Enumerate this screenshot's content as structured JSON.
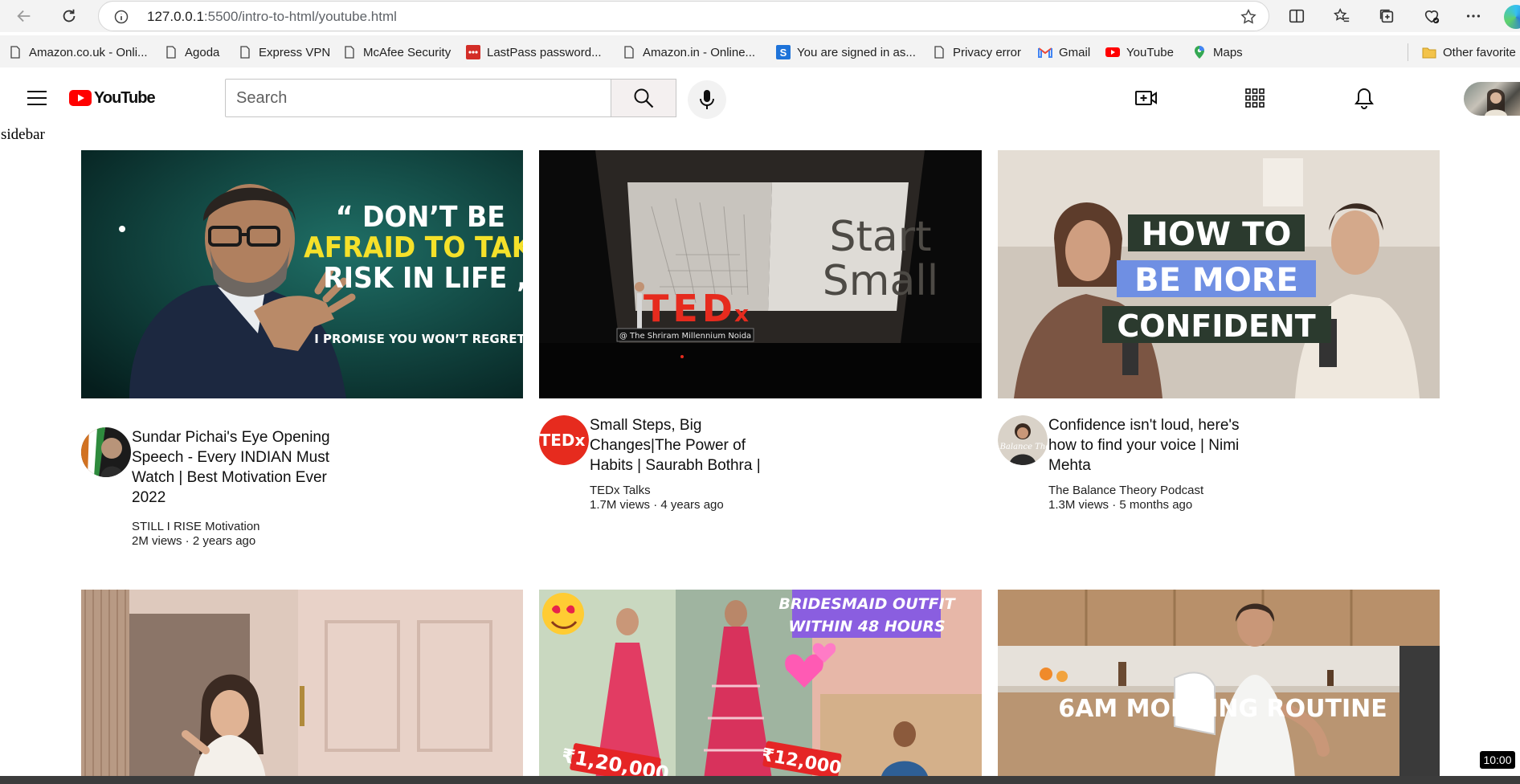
{
  "browser": {
    "url_host": "127.0.0.1",
    "url_path": ":5500/intro-to-html/youtube.html",
    "bookmarks": [
      {
        "label": "Amazon.co.uk - Onli...",
        "icon": "page-icon"
      },
      {
        "label": "Agoda",
        "icon": "page-icon"
      },
      {
        "label": "Express VPN",
        "icon": "page-icon"
      },
      {
        "label": "McAfee Security",
        "icon": "page-icon"
      },
      {
        "label": "LastPass password...",
        "icon": "lastpass-icon"
      },
      {
        "label": "Amazon.in - Online...",
        "icon": "page-icon"
      },
      {
        "label": "You are signed in as...",
        "icon": "s-icon"
      },
      {
        "label": "Privacy error",
        "icon": "page-icon"
      },
      {
        "label": "Gmail",
        "icon": "gmail-icon"
      },
      {
        "label": "YouTube",
        "icon": "youtube-icon"
      },
      {
        "label": "Maps",
        "icon": "maps-icon"
      },
      {
        "label": "Other favorite",
        "icon": "folder-icon"
      }
    ]
  },
  "header": {
    "logo_text": "YouTube",
    "search_placeholder": "Search"
  },
  "sidebar": {
    "label": "sidebar"
  },
  "videos": [
    {
      "title": "Sundar Pichai's Eye Opening Speech - Every INDIAN Must Watch | Best Motivation Ever 2022",
      "channel": "STILL I RISE Motivation",
      "stats": "2M views · 2 years ago",
      "thumb_lines": [
        "“ DON’T BE",
        "AFRAID TO TAKE",
        "RISK IN LIFE „",
        "I PROMISE YOU WON’T REGRET  IT"
      ]
    },
    {
      "title": "Small Steps, Big Changes|The Power of Habits | Saurabh Bothra |",
      "channel": "TEDx Talks",
      "stats": "1.7M views · 4 years ago",
      "thumb_lines": [
        "Start",
        "Small",
        "TED",
        "x",
        "@ The Shriram Millennium Noida"
      ],
      "avatar_text": "TEDx"
    },
    {
      "title": "Confidence isn't loud, here's how to find your voice | Nimi Mehta",
      "channel": "The Balance Theory Podcast",
      "stats": "1.3M views · 5 months ago",
      "thumb_lines": [
        "HOW TO",
        "BE MORE",
        "CONFIDENT"
      ],
      "avatar_text": "The Balance Theory"
    },
    {
      "thumb_lines": []
    },
    {
      "thumb_lines": [
        "BRIDESMAID OUTFIT",
        "WITHIN 48 HOURS",
        "₹1,20,000",
        "₹12,000"
      ]
    },
    {
      "thumb_lines": [
        "6AM MORNING ROUTINE"
      ]
    }
  ],
  "time_badge": "10:00",
  "colors": {
    "youtube_red": "#ff0000",
    "tedx_red": "#e62b1e",
    "chrome_bg": "#f3f3f3"
  }
}
